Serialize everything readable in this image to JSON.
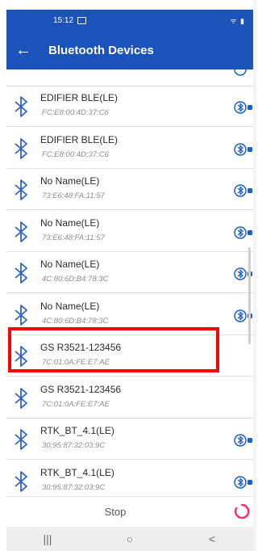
{
  "status_bar": {
    "time": "15:12",
    "notification_icon": "image-icon",
    "right_icons": "signal-wifi-battery"
  },
  "app_bar": {
    "back_icon": "arrow-left-icon",
    "title": "Bluetooth Devices",
    "color": "#1c53bb"
  },
  "devices": [
    {
      "name": "EDIFIER BLE(LE)",
      "mac": "FC:E8:00:4D:37:C6",
      "connectable": true
    },
    {
      "name": "EDIFIER BLE(LE)",
      "mac": "FC:E8:00:4D:37:C6",
      "connectable": true
    },
    {
      "name": "No Name(LE)",
      "mac": "73:E6:48:FA:11:57",
      "connectable": true
    },
    {
      "name": "No Name(LE)",
      "mac": "73:E6:48:FA:11:57",
      "connectable": true
    },
    {
      "name": "No Name(LE)",
      "mac": "4C:80:6D:B4:78:3C",
      "connectable": true
    },
    {
      "name": "No Name(LE)",
      "mac": "4C:80:6D:B4:78:3C",
      "connectable": true
    },
    {
      "name": "GS R3521-123456",
      "mac": "7C:01:0A:FE:E7:AE",
      "connectable": false
    },
    {
      "name": "GS R3521-123456",
      "mac": "7C:01:0A:FE:E7:AE",
      "connectable": false
    },
    {
      "name": "RTK_BT_4.1(LE)",
      "mac": "30:95:87:32:03:9C",
      "connectable": true
    },
    {
      "name": "RTK_BT_4.1(LE)",
      "mac": "30:95:87:32:03:9C",
      "connectable": true
    }
  ],
  "highlight": {
    "color": "#ff0000"
  },
  "footer": {
    "stop_label": "Stop",
    "spinner_color": "#ff2d6f"
  },
  "nav_bar": {
    "recents": "|||",
    "home": "○",
    "back": "<"
  }
}
